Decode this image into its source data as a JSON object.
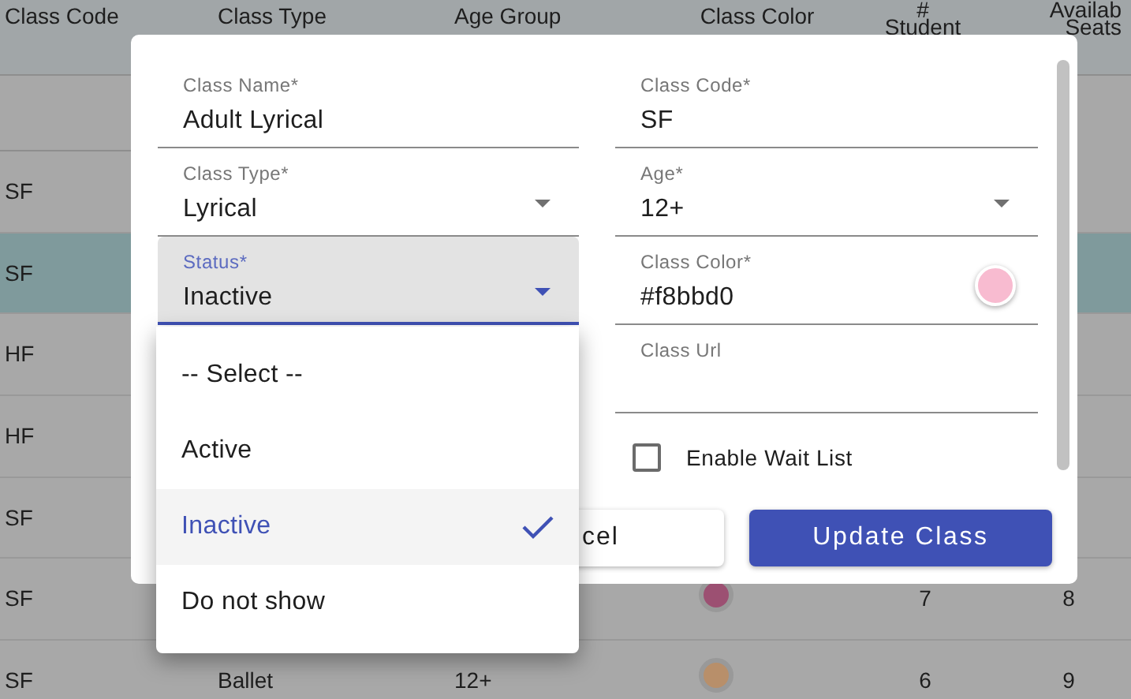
{
  "table": {
    "columns": [
      {
        "lines": [
          "Class Code"
        ]
      },
      {
        "lines": [
          "Class Type"
        ]
      },
      {
        "lines": [
          "Age Group"
        ]
      },
      {
        "lines": [
          "Class Color"
        ]
      },
      {
        "lines": [
          "#",
          "Student"
        ]
      },
      {
        "lines": [
          "Availab",
          "Seats"
        ]
      }
    ],
    "rows": [
      {
        "selected": false,
        "cells": {
          "code": "SF"
        }
      },
      {
        "selected": true,
        "cells": {
          "code": "SF"
        }
      },
      {
        "selected": false,
        "cells": {
          "code": "HF"
        }
      },
      {
        "selected": false,
        "cells": {
          "code": "HF"
        }
      },
      {
        "selected": false,
        "cells": {
          "code": "SF"
        }
      },
      {
        "selected": false,
        "color": "#9c5072",
        "cells": {
          "code": "SF",
          "students": "7",
          "seats": "8"
        }
      },
      {
        "selected": false,
        "color": "#b88f6a",
        "cells": {
          "code": "SF",
          "type": "Ballet",
          "age": "12+",
          "students": "6",
          "seats": "9"
        }
      }
    ]
  },
  "dialog": {
    "fields": [
      {
        "kind": "text",
        "label": "Class Name*",
        "value": "Adult Lyrical",
        "focused": false
      },
      {
        "kind": "text",
        "label": "Class Code*",
        "value": "SF",
        "focused": false
      },
      {
        "kind": "select",
        "label": "Class Type*",
        "value": "Lyrical",
        "focused": false
      },
      {
        "kind": "select",
        "label": "Age*",
        "value": "12+",
        "focused": false
      },
      {
        "kind": "select",
        "label": "Status*",
        "value": "Inactive",
        "focused": true
      },
      {
        "kind": "color",
        "label": "Class Color*",
        "value": "#f8bbd0",
        "color": "#f8bbd0",
        "focused": false
      },
      {
        "kind": "hidden"
      },
      {
        "kind": "text",
        "label": "Class Url",
        "focused": false
      }
    ],
    "checkbox": {
      "label": "Enable Wait List",
      "checked": false
    },
    "buttons": [
      {
        "kind": "secondary",
        "label": "cel"
      },
      {
        "kind": "primary",
        "label": "Update Class"
      }
    ]
  },
  "menu": {
    "options": [
      {
        "label": "-- Select --",
        "selected": false
      },
      {
        "label": "Active",
        "selected": false
      },
      {
        "label": "Inactive",
        "selected": true
      },
      {
        "label": "Do not show",
        "selected": false
      }
    ]
  }
}
